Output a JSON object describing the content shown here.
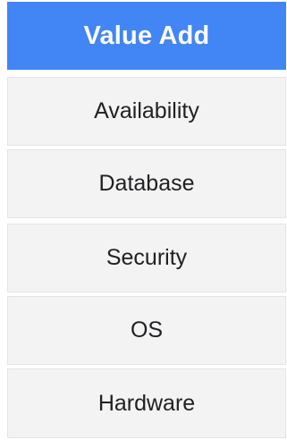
{
  "header": {
    "title": "Value Add",
    "background_color": "#4285f4"
  },
  "rows": [
    {
      "label": "Availability"
    },
    {
      "label": "Database"
    },
    {
      "label": "Security"
    },
    {
      "label": "OS"
    },
    {
      "label": "Hardware"
    }
  ],
  "colors": {
    "row_background": "#f3f3f3",
    "row_border": "#e4e4e4",
    "row_text": "#202124",
    "header_text": "#ffffff"
  }
}
